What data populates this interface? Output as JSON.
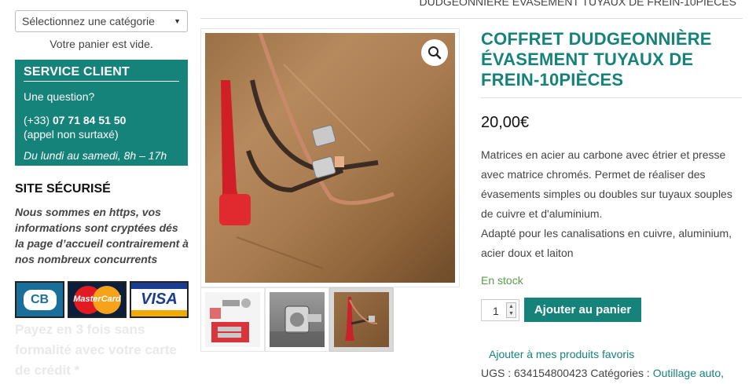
{
  "sidebar": {
    "category_select": "Sélectionnez une catégorie",
    "cart_empty": "Votre panier est vide.",
    "service": {
      "title": "SERVICE CLIENT",
      "question": "Une question?",
      "phone_prefix": "(+33)",
      "phone_number": "07 71 84 51 50",
      "phone_note": "(appel non surtaxé)",
      "hours": "Du lundi au samedi, 8h – 17h"
    },
    "secure": {
      "title": "SITE SÉCURISÉ",
      "text": "Nous sommes en https, vos informations sont cryptées dés la page d’accueil contrairement à nos nombreux concurrents"
    },
    "cards": {
      "cb": "CB",
      "mastercard": "MasterCard",
      "visa": "VISA"
    },
    "pay_3x": "Payez en 3 fois sans formalité avec votre carte de crédit *"
  },
  "breadcrumb": "DUDGEONNIÈRE ÉVASEMENT TUYAUX DE FREIN-10PIÈCES",
  "product": {
    "title": "COFFRET DUDGEONNIÈRE ÉVASEMENT TUYAUX DE FREIN-10PIÈCES",
    "price": "20,00€",
    "description_1": "Matrices en acier au carbone avec étrier et presse avec matrice chromés. Permet de réaliser des évasements simples ou doubles sur tuyaux souples de cuivre et d'aluminium.",
    "description_2": "Adapté pour les canalisations en cuivre, aluminium, acier doux et laiton",
    "stock": "En stock",
    "quantity": "1",
    "add_to_cart": "Ajouter au panier",
    "wishlist": "Ajouter à mes produits favoris",
    "sku_label": "UGS :",
    "sku": "634154800423",
    "categories_label": "Catégories :",
    "category_link": "Outillage auto,"
  },
  "colors": {
    "accent": "#16837b",
    "stock": "#5a9e48"
  },
  "icons": {
    "zoom": "magnifier-icon"
  }
}
